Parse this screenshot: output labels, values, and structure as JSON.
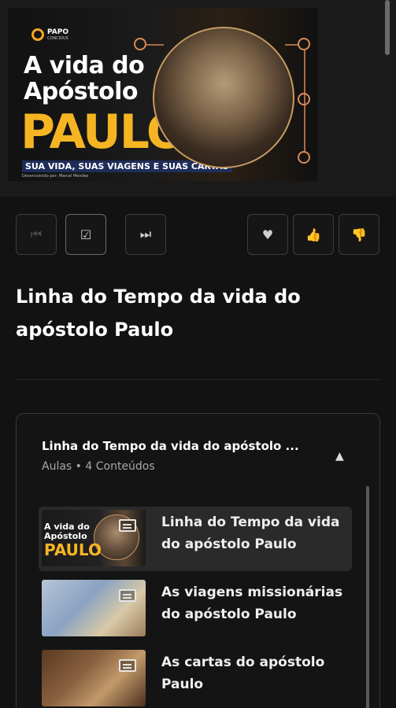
{
  "hero": {
    "logo_text": "PAPO",
    "logo_sub": "CONCIDUS",
    "line1": "A vida do",
    "line2": "Apóstolo",
    "line3": "PAULO",
    "tagline": "SUA VIDA, SUAS VIAGENS E SUAS CARTAS",
    "credit": "Desenvolvido por: Marcel Mendes"
  },
  "controls": {
    "prev_icon": "skip-previous-icon",
    "complete_icon": "checkbox-icon",
    "next_icon": "skip-next-icon",
    "favorite_icon": "heart-icon",
    "like_icon": "thumbs-up-icon",
    "dislike_icon": "thumbs-down-icon"
  },
  "lesson_title": "Linha do Tempo da vida do apóstolo Paulo",
  "module": {
    "title": "Linha do Tempo da vida do apóstolo ...",
    "subtitle": "Aulas • 4 Conteúdos",
    "lessons": [
      {
        "label": "Linha do Tempo da vida do apóstolo Paulo",
        "active": true,
        "thumb_line1": "A vida do",
        "thumb_line2": "Apóstolo",
        "thumb_line3": "PAULO"
      },
      {
        "label": "As viagens missionárias do apóstolo Paulo",
        "active": false
      },
      {
        "label": "As cartas do apóstolo Paulo",
        "active": false
      }
    ]
  }
}
